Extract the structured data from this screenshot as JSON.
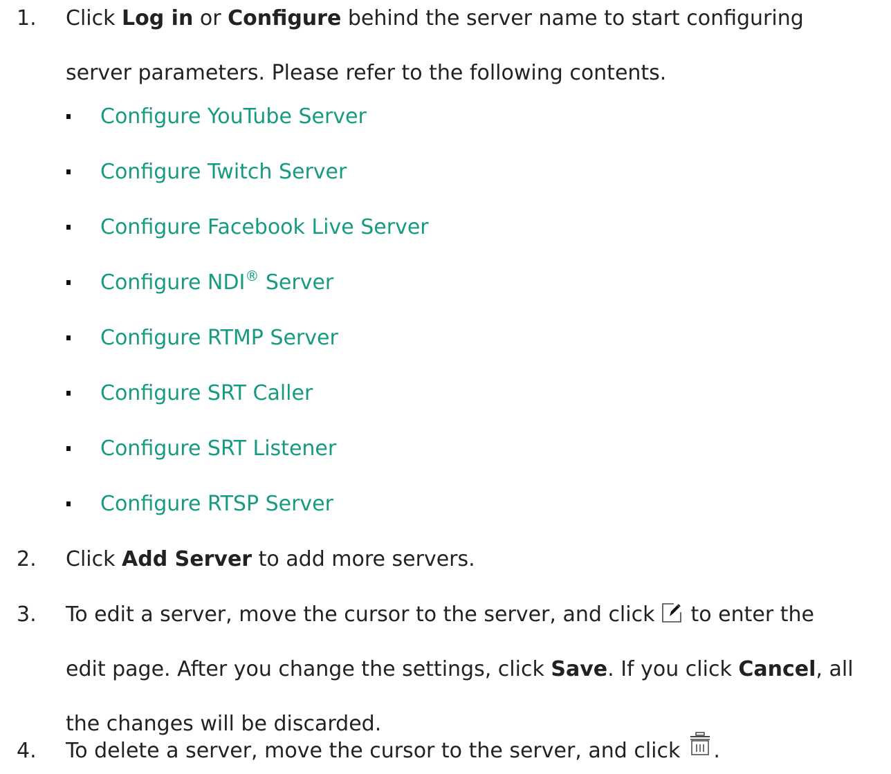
{
  "steps": [
    {
      "num": "1.",
      "lines": [
        {
          "pre": "Click ",
          "b1": "Log in",
          "mid": " or ",
          "b2": "Configure",
          "post": " behind the server name to start configuring"
        },
        {
          "text": "server parameters. Please refer to the following contents."
        }
      ]
    },
    {
      "num": "2.",
      "line": {
        "pre": "Click ",
        "bold": "Add Server",
        "post": " to add more servers."
      }
    },
    {
      "num": "3.",
      "line1_pre": "To edit a server, move the cursor to the server, and click",
      "line1_post": "to enter the",
      "line2_pre": "edit page. After you change the settings, click ",
      "line2_bold1": "Save",
      "line2_mid": ". If you click ",
      "line2_bold2": "Cancel",
      "line2_post": ", all",
      "line3": "the changes will be discarded."
    },
    {
      "num": "4.",
      "text_pre": "To delete a server, move the cursor to the server, and click",
      "text_post": "."
    }
  ],
  "links": [
    {
      "label": "Configure YouTube Server"
    },
    {
      "label": "Configure Twitch Server"
    },
    {
      "label": "Configure Facebook Live Server"
    },
    {
      "label": "Configure NDI",
      "sup": "®",
      "label_post": " Server"
    },
    {
      "label": "Configure RTMP Server"
    },
    {
      "label": "Configure SRT Caller"
    },
    {
      "label": "Configure SRT Listener"
    },
    {
      "label": "Configure RTSP Server"
    }
  ],
  "colors": {
    "link": "#169b82",
    "text": "#222222"
  },
  "icons": {
    "edit": "edit-icon",
    "delete": "trash-icon"
  }
}
